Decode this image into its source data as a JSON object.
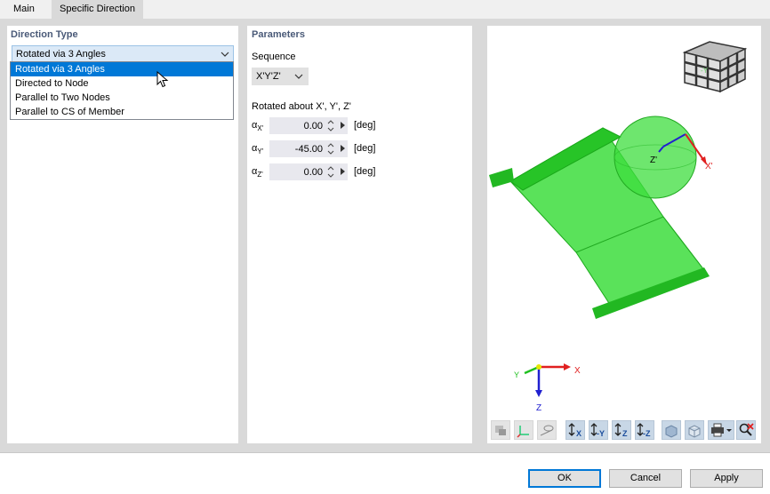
{
  "tabs": [
    {
      "label": "Main",
      "active": false
    },
    {
      "label": "Specific Direction",
      "active": true
    }
  ],
  "direction_type": {
    "title": "Direction Type",
    "selected": "Rotated via 3 Angles",
    "options": [
      "Rotated via 3 Angles",
      "Directed to Node",
      "Parallel to Two Nodes",
      "Parallel to CS of Member"
    ]
  },
  "parameters": {
    "title": "Parameters",
    "sequence_label": "Sequence",
    "sequence_value": "X'Y'Z'",
    "rotated_label": "Rotated about X', Y', Z'",
    "angles": [
      {
        "symbol": "α",
        "axis": "X'",
        "value": "0.00",
        "unit": "[deg]"
      },
      {
        "symbol": "α",
        "axis": "Y'",
        "value": "-45.00",
        "unit": "[deg]"
      },
      {
        "symbol": "α",
        "axis": "Z'",
        "value": "0.00",
        "unit": "[deg]"
      }
    ]
  },
  "viewport": {
    "local_axes": {
      "x": "X'",
      "z": "Z'"
    },
    "global_axes": {
      "x": "X",
      "y": "Y",
      "z": "Z"
    },
    "cube_face_label": "-Y",
    "model_color": "#33dd33",
    "toolbar_icons": [
      "view-settings-icon",
      "axis-system-icon",
      "render-icon",
      "axis-x-icon",
      "axis-neg-y-icon",
      "axis-z-icon",
      "axis-neg-z-icon",
      "iso-view-icon",
      "wireframe-cube-icon",
      "print-icon",
      "reset-view-icon"
    ],
    "toolbar_labels": [
      "X",
      "-Y",
      "Z",
      "-Z"
    ]
  },
  "footer": {
    "ok_label": "OK",
    "cancel_label": "Cancel",
    "apply_label": "Apply"
  },
  "colors": {
    "accent": "#0078d7",
    "panel_title": "#4a5a78",
    "x_axis": "#e02020",
    "y_axis": "#20c020",
    "z_axis": "#2020d0"
  }
}
